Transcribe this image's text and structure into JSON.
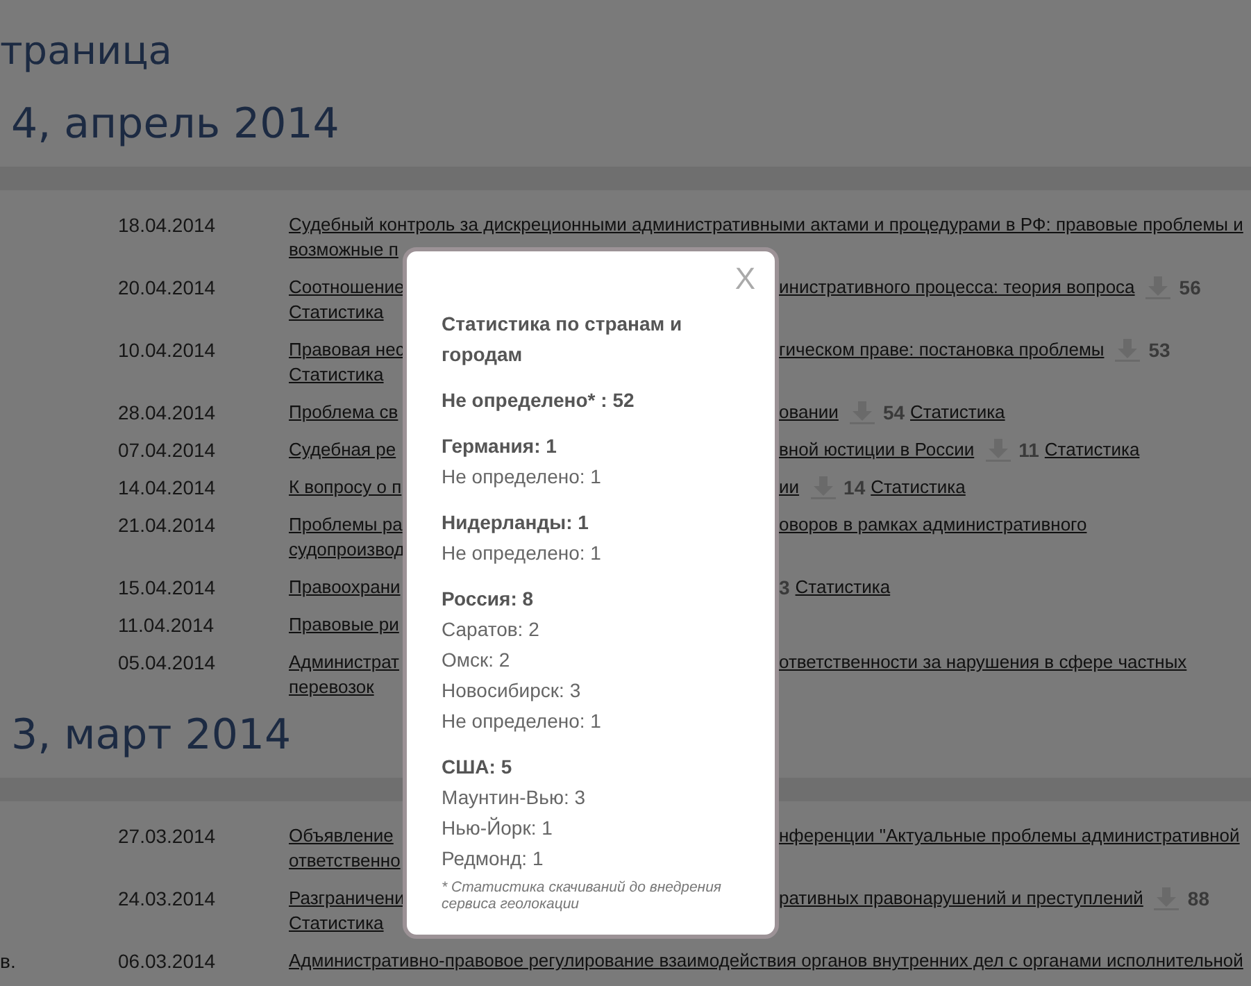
{
  "page_title": "траница",
  "sections": [
    {
      "heading": "4, апрель 2014",
      "rows": [
        {
          "date": "18.04.2014",
          "lines": [
            {
              "kind": "full",
              "left": "Судебный контроль за дискреционными административными актами и процедурами в РФ: правовые проблемы и"
            },
            {
              "kind": "split",
              "left": "возможные п"
            }
          ]
        },
        {
          "date": "20.04.2014",
          "lines": [
            {
              "kind": "split",
              "left": "Соотношение",
              "right": [
                {
                  "kind": "link",
                  "text": "инистративного процесса: теория вопроса"
                },
                {
                  "kind": "download"
                },
                {
                  "kind": "count",
                  "text": "56"
                }
              ]
            },
            {
              "kind": "split",
              "left": "Статистика"
            }
          ]
        },
        {
          "date": "10.04.2014",
          "lines": [
            {
              "kind": "split",
              "left": "Правовая нес",
              "right": [
                {
                  "kind": "link",
                  "text": "гическом праве: постановка проблемы"
                },
                {
                  "kind": "download"
                },
                {
                  "kind": "count",
                  "text": "53"
                }
              ]
            },
            {
              "kind": "split",
              "left": "Статистика"
            }
          ]
        },
        {
          "date": "28.04.2014",
          "lines": [
            {
              "kind": "split",
              "left": "Проблема св",
              "right": [
                {
                  "kind": "link",
                  "text": "овании"
                },
                {
                  "kind": "download"
                },
                {
                  "kind": "count",
                  "text": "54"
                },
                {
                  "kind": "link",
                  "text": "Статистика"
                }
              ]
            }
          ]
        },
        {
          "date": "07.04.2014",
          "lines": [
            {
              "kind": "split",
              "left": "Судебная ре",
              "right": [
                {
                  "kind": "link",
                  "text": "вной юстиции в России"
                },
                {
                  "kind": "download"
                },
                {
                  "kind": "count",
                  "text": "11"
                },
                {
                  "kind": "link",
                  "text": "Статистика"
                }
              ]
            }
          ]
        },
        {
          "date": "14.04.2014",
          "lines": [
            {
              "kind": "split",
              "left": "К вопросу о п",
              "right": [
                {
                  "kind": "link",
                  "text": "ии"
                },
                {
                  "kind": "download"
                },
                {
                  "kind": "count",
                  "text": "14"
                },
                {
                  "kind": "link",
                  "text": "Статистика"
                }
              ]
            }
          ]
        },
        {
          "date": "21.04.2014",
          "lines": [
            {
              "kind": "split",
              "left": "Проблемы ра",
              "right": [
                {
                  "kind": "link",
                  "text": "оворов в рамках административного"
                }
              ]
            },
            {
              "kind": "split",
              "left": "судопроизвод"
            }
          ]
        },
        {
          "date": "15.04.2014",
          "lines": [
            {
              "kind": "split",
              "left": "Правоохрани",
              "right": [
                {
                  "kind": "count",
                  "text": "3"
                },
                {
                  "kind": "link",
                  "text": "Статистика"
                }
              ]
            }
          ]
        },
        {
          "date": "11.04.2014",
          "lines": [
            {
              "kind": "split",
              "left": "Правовые ри"
            }
          ]
        },
        {
          "date": "05.04.2014",
          "lines": [
            {
              "kind": "split",
              "left": "Администрат",
              "right": [
                {
                  "kind": "link",
                  "text": "ответственности за нарушения в сфере частных"
                }
              ]
            },
            {
              "kind": "split",
              "left": "перевозок"
            }
          ]
        }
      ]
    },
    {
      "heading": "3, март 2014",
      "rows": [
        {
          "date": "27.03.2014",
          "lines": [
            {
              "kind": "split",
              "left": "Объявление",
              "right": [
                {
                  "kind": "link",
                  "text": "нференции \"Актуальные проблемы административной"
                }
              ]
            },
            {
              "kind": "split",
              "left": "ответственно"
            }
          ]
        },
        {
          "date": "24.03.2014",
          "lines": [
            {
              "kind": "split",
              "left": "Разграничени",
              "right": [
                {
                  "kind": "link",
                  "text": "ративных правонарушений и преступлений"
                },
                {
                  "kind": "download"
                },
                {
                  "kind": "count",
                  "text": "88"
                }
              ]
            },
            {
              "kind": "split",
              "left": "Статистика"
            }
          ]
        },
        {
          "side": "в.",
          "date": "06.03.2014",
          "lines": [
            {
              "kind": "full",
              "left": "Административно-правовое регулирование взаимодействия органов внутренних дел с органами исполнительной"
            }
          ]
        }
      ]
    }
  ],
  "modal": {
    "close": "X",
    "title": "Статистика по странам и городам",
    "total": "Не определено* : 52",
    "groups": [
      {
        "country": "Германия: 1",
        "cities": [
          "Не определено: 1"
        ]
      },
      {
        "country": "Нидерланды: 1",
        "cities": [
          "Не определено: 1"
        ]
      },
      {
        "country": "Россия: 8",
        "cities": [
          "Саратов: 2",
          "Омск: 2",
          "Новосибирск: 3",
          "Не определено: 1"
        ]
      },
      {
        "country": "США: 5",
        "cities": [
          "Маунтин-Вью: 3",
          "Нью-Йорк: 1",
          "Редмонд: 1"
        ]
      }
    ],
    "footnote": "* Статистика скачиваний до внедрения сервиса геолокации"
  }
}
